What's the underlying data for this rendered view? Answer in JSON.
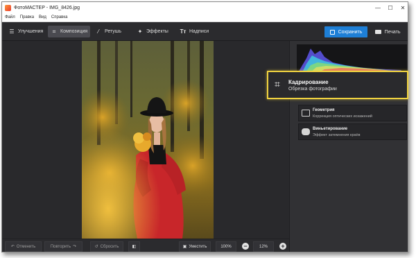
{
  "window": {
    "title": "ФотоМАСТЕР - IMG_8426.jpg"
  },
  "menu": [
    "Файл",
    "Правка",
    "Вид",
    "Справка"
  ],
  "tabs": [
    {
      "label": "Улучшения",
      "icon": "sliders-icon",
      "active": false
    },
    {
      "label": "Композиция",
      "icon": "crop-icon",
      "active": true
    },
    {
      "label": "Ретушь",
      "icon": "brush-icon",
      "active": false
    },
    {
      "label": "Эффекты",
      "icon": "magic-wand-icon",
      "active": false
    },
    {
      "label": "Надписи",
      "icon": "text-icon",
      "active": false
    }
  ],
  "toolbar": {
    "save_label": "Сохранить",
    "print_label": "Печать",
    "accent_color": "#1e7fd6"
  },
  "tools": {
    "crop": {
      "title": "Кадрирование",
      "subtitle": "Обрезка фотографии"
    },
    "geometry": {
      "title": "Геометрия",
      "subtitle": "Коррекция оптических искажений"
    },
    "vignette": {
      "title": "Виньетирование",
      "subtitle": "Эффект затемнения краёв"
    }
  },
  "highlight_color": "#f0d240",
  "bottom": {
    "undo_label": "Отменить",
    "redo_label": "Повторить",
    "reset_label": "Сбросить",
    "fit_label": "Уместить",
    "zoom_100": "100%",
    "zoom_current": "12%"
  }
}
